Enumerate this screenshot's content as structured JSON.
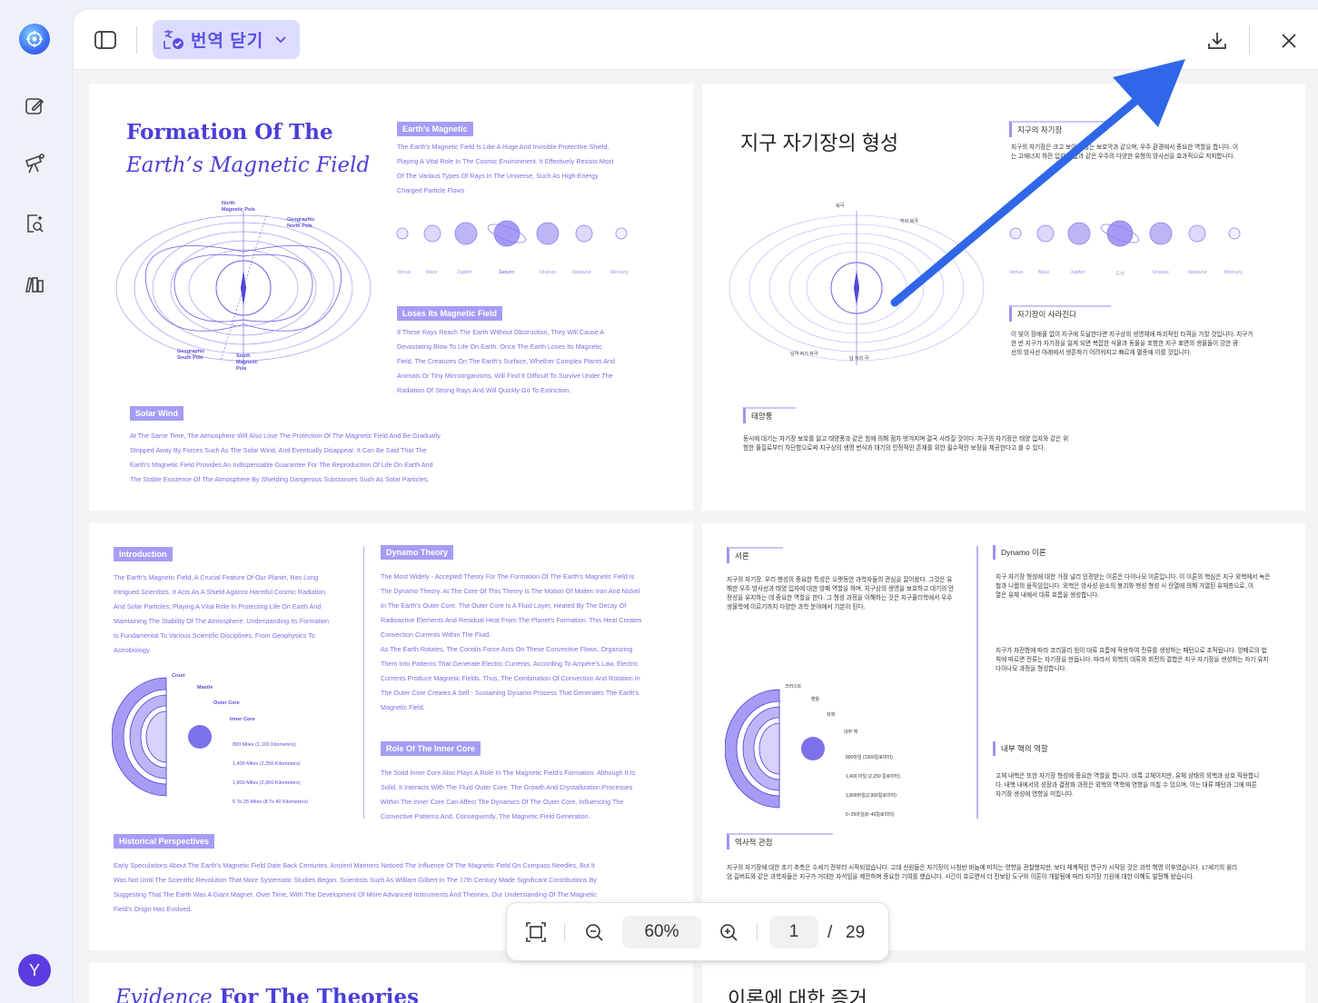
{
  "sidebar": {
    "avatar_initial": "Y"
  },
  "toolbar": {
    "translate_label": "번역 닫기"
  },
  "zoombar": {
    "zoom": "60%",
    "current_page": "1",
    "separator": "/",
    "total_pages": "29"
  },
  "page1": {
    "title_line1": "Formation Of The",
    "title_line2": "Earth’s Magnetic Field",
    "tag_magnetic": "Earth's Magnetic",
    "magnetic_lines": [
      "The Earth's Magnetic Field Is Like A Huge And Invisible Protective Shield,",
      "Playing A Vital Role In The Cosmic Environment. It Effectively Resists Most",
      "Of The Various Types Of Rays In The Universe, Such As High-Energy",
      "Charged Particle Flows"
    ],
    "planets": [
      "Venus",
      "Mars",
      "Jupiter",
      "Saturn",
      "Uranus",
      "Neptune",
      "Mercury"
    ],
    "tag_loses": "Loses Its Magnetic Field",
    "loses_lines": [
      "If These Rays Reach The Earth Without Obstruction, They Will Cause A",
      "Devastating Blow To Life On Earth. Once The Earth Loses Its Magnetic",
      "Field, The Creatures On The Earth's Surface, Whether Complex Plants And",
      "Animals Or Tiny Microorganisms, Will Find It Difficult To Survive Under The",
      "Radiation Of Strong Rays And Will Quickly Go To Extinction."
    ],
    "tag_solar": "Solar Wind",
    "solar_lines": [
      "At The Same Time, The Atmosphere Will Also Lose The Protection Of The Magnetic Field And Be Gradually",
      "Stripped Away By Forces Such As The Solar Wind, And Eventually Disappear. It Can Be Said That The",
      "Earth's Magnetic Field Provides An Indispensable Guarantee For The Reproduction Of Life On Earth And",
      "The Stable Existence Of The Atmosphere By Shielding Dangerous Substances Such As Solar Particles."
    ],
    "diagram": {
      "north_magnetic": "North\nMagnetic Pole",
      "geo_north": "Geographic\nNorth Pole",
      "geo_south": "Geographic\nSouth Pole",
      "south_magnetic": "South\nMagnetic\nPole",
      "angle": "1.5"
    }
  },
  "page2": {
    "title": "지구 자기장의 형성",
    "tag_magnetic": "지구의 자기장",
    "magnetic_lines": [
      "지구의 자기장은 크고 보이지 않는 보호막과 같으며, 우주 환경에서 중요한 역할을 합니다. 이",
      "는 고에너지 하전 입자 흐름과 같은 우주의 다양한 유형의 방사선을 효과적으로 저지합니다."
    ],
    "planets": [
      "Venus",
      "Mars",
      "Jupiter",
      "토성",
      "Uranus",
      "Neptune",
      "Mercury"
    ],
    "tag_loses": "자기장이 사라진다",
    "loses_lines": [
      "이 빛이 장애물 없이 지구에 도달한다면 지구상의 생명체에 파괴적인 타격을 가할 것입니다. 지구가",
      "한 번 지구가 자기장을 잃게 되면 복잡한 식물과 동물을 포함한 지구 표면의 생물들이 강한 광",
      "선의 방사선 아래에서 생존하기 어려워지고 빠르게 멸종에 이를 것입니다."
    ],
    "tag_solar": "태양풍",
    "solar_lines": [
      "동시에 대기는 자기장 보호를 잃고 태양풍과 같은 힘에 의해 점차 벗겨지며 결국 사라질 것이다. 지구의 자기장은 태양 입자와 같은 위",
      "험한 물질로부터 차단함으로써 지구상의 생명 번식과 대기의 안정적인 존재를 위한 필수적인 보장을 제공한다고 볼 수 있다."
    ],
    "diagram": {
      "north": "북극",
      "geo_north": "지리 북극",
      "south_magnetic": "남극 자기 자극",
      "geo_south": "남 지리 극",
      "angle": "1.5"
    }
  },
  "page3": {
    "tag_intro": "Introduction",
    "intro_lines": [
      "The Earth's Magnetic Field, A Crucial Feature Of Our Planet, Has Long",
      "Intrigued Scientists. It Acts As A Shield Against Harmful Cosmic Radiation",
      "And Solar Particles, Playing A Vital Role In Protecting Life On Earth And",
      "Maintaining The Stability Of The Atmosphere. Understanding Its Formation",
      "Is Fundamental To Various Scientific Disciplines, From Geophysics To",
      "Astrobiology."
    ],
    "layers": [
      "Crust",
      "Mantle",
      "Outer Core",
      "Inner Core"
    ],
    "depths": [
      "800 Miles (1,100 Kilometers)",
      "1,400 Miles (2,250 Kilometers)",
      "1,800 Miles (2,900 Kilometers)",
      "5 To 25 Miles (8 To 40 Kilometers)"
    ],
    "tag_dynamo": "Dynamo Theory",
    "dynamo_lines": [
      "The Most Widely - Accepted Theory For The Formation Of The Earth's Magnetic Field Is",
      "The Dynamo Theory. At The Core Of This Theory Is The Motion Of Molten Iron And Nickel",
      "In The Earth's Outer Core. The Outer Core Is A Fluid Layer, Heated By The Decay Of",
      "Radioactive Elements And Residual Heat From The Planet's Formation. This Heat Creates",
      "Convection Currents Within The Fluid.",
      "As The Earth Rotates, The Coriolis Force Acts On These Convective Flows, Organizing",
      "Them Into Patterns That Generate Electric Currents. According To Ampère's Law, Electric",
      "Currents Produce Magnetic Fields. Thus, The Combination Of Convection And Rotation In",
      "The Outer Core Creates A Self - Sustaining Dynamo Process That Generates The Earth's",
      "Magnetic Field."
    ],
    "tag_inner": "Role Of The Inner Core",
    "inner_lines": [
      "The Solid Inner Core Also Plays A Role In The Magnetic Field's Formation. Although It Is",
      "Solid, It Interacts With The Fluid Outer Core. The Growth And Crystallization Processes",
      "Within The Inner Core Can Affect The Dynamics Of The Outer Core, Influencing The",
      "Convective Patterns And, Consequently, The Magnetic Field Generation."
    ],
    "tag_history": "Historical Perspectives",
    "history_lines": [
      "Early Speculations About The Earth's Magnetic Field Date Back Centuries. Ancient Mariners Noticed The Influence Of The Magnetic Field On Compass Needles, But It",
      "Was Not Until The Scientific Revolution That More Systematic Studies Began. Scientists Such As William Gilbert In The 17th Century Made Significant Contributions By",
      "Suggesting That The Earth Was A Giant Magnet. Over Time, With The Development Of More Advanced Instruments And Theories, Our Understanding Of The Magnetic",
      "Field's Origin Has Evolved."
    ]
  },
  "page4": {
    "tag_intro": "서론",
    "intro_lines": [
      "지구의 자기장, 우리 행성의 중요한 특성은 오랫동안 과학자들의 관심을 끌어왔다. 그것은 유",
      "해한 우주 방사선과 태양 입자에 대한 방패 역할을 하며, 지구상의 생명을 보호하고 대기의 안",
      "정성을 유지하는 데 중요한 역할을 한다. 그 형성 과정을 이해하는 것은 지구물리학에서 우주",
      "생물학에 이르기까지 다양한 과학 분야에서 기본이 된다."
    ],
    "layers": [
      "크러스트",
      "맨틀",
      "외핵",
      "내부 핵"
    ],
    "depths": [
      "800마일 (1300킬로미터)",
      "1,400 마일 (2,250 킬로미터)",
      "1,800마일(2,900킬로미터)",
      "5~25마일(8~40킬로미터)"
    ],
    "tag_dynamo": "Dynamo 이론",
    "dynamo_lines": [
      "지구 자기장 형성에 대한 가장 널리 인정받는 이론은 다이나모 이론입니다. 이 이론의 핵심은 지구 외핵에서 녹은",
      "철과 니켈의 움직임입니다. 외핵은 방사성 원소의 붕괴와 행성 형성 시 잔열에 의해 가열된 유체층으로, 이",
      "열은 유체 내에서 대류 흐름을 생성합니다."
    ],
    "dynamo_lines2": [
      "지구가 자전함에 따라 코리올리 힘이 대류 흐름에 작용하여 전류를 생성하는 패턴으로 조직됩니다. 앙페르의 법",
      "칙에 따르면 전류는 자기장을 만듭니다. 따라서 외핵의 대류와 회전의 결합은 지구 자기장을 생성하는 자기 유지",
      "다이나모 과정을 형성합니다."
    ],
    "tag_inner": "내부 핵의 역할",
    "inner_lines": [
      "고체 내핵은 또한 자기장 형성에 중요한 역할을 합니다. 비록 고체이지만, 유체 상태의 외핵과 상호 작용합니",
      "다. 내핵 내에서의 성장과 결정화 과정은 외핵의 역학에 영향을 미칠 수 있으며, 이는 대류 패턴과 그에 따른",
      "자기장 생성에 영향을 미칩니다."
    ],
    "tag_history": "역사적 관점",
    "history_lines": [
      "지구의 자기장에 대한 초기 추측은 수세기 전부터 시작되었습니다. 고대 선원들은 자기장이 나침반 바늘에 미치는 영향을 관찰했지만, 보다 체계적인 연구가 시작된 것은 과학 혁명 이후였습니다. 17세기의 윌리",
      "엄 길버트와 같은 과학자들은 지구가 거대한 자석임을 제안하며 중요한 기여를 했습니다. 시간이 흐르면서 더 진보된 도구와 이론이 개발됨에 따라 자기장 기원에 대한 이해도 발전해 왔습니다."
    ]
  },
  "page5": {
    "title_part1": "Evidence",
    "title_part2": " For The Theories"
  },
  "page6": {
    "title": "이론에 대한 증거"
  }
}
